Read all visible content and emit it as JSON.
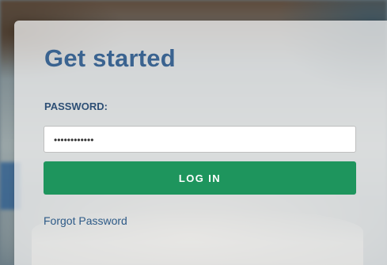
{
  "form": {
    "title": "Get started",
    "password_label": "PASSWORD:",
    "password_value": "••••••••••••",
    "login_label": "LOG IN",
    "forgot_label": "Forgot Password"
  }
}
